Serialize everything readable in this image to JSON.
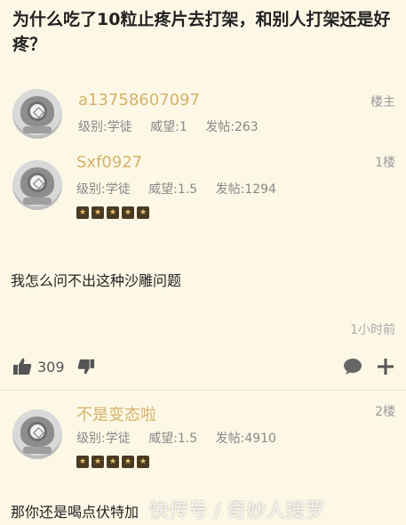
{
  "title": "为什么吃了10粒止疼片去打架，和别人打架还是好疼？",
  "op": {
    "username": "a13758607097",
    "level": "级别:学徒",
    "prestige": "威望:1",
    "posts": "发帖:263",
    "floor": "楼主"
  },
  "reply1": {
    "username": "Sxf0927",
    "level": "级别:学徒",
    "prestige": "威望:1.5",
    "posts": "发帖:1294",
    "floor": "1楼",
    "content": "我怎么问不出这种沙雕问题",
    "time": "1小时前",
    "likes": "309"
  },
  "reply2": {
    "username": "不是变态啦",
    "level": "级别:学徒",
    "prestige": "威望:1.5",
    "posts": "发帖:4910",
    "floor": "2楼",
    "content": "那你还是喝点伏特加",
    "watermark": "快传号 / 奇妙人搜罗"
  },
  "colors": {
    "background": "#fdf8e6",
    "username": "#d4b26a",
    "meta": "#888888"
  }
}
